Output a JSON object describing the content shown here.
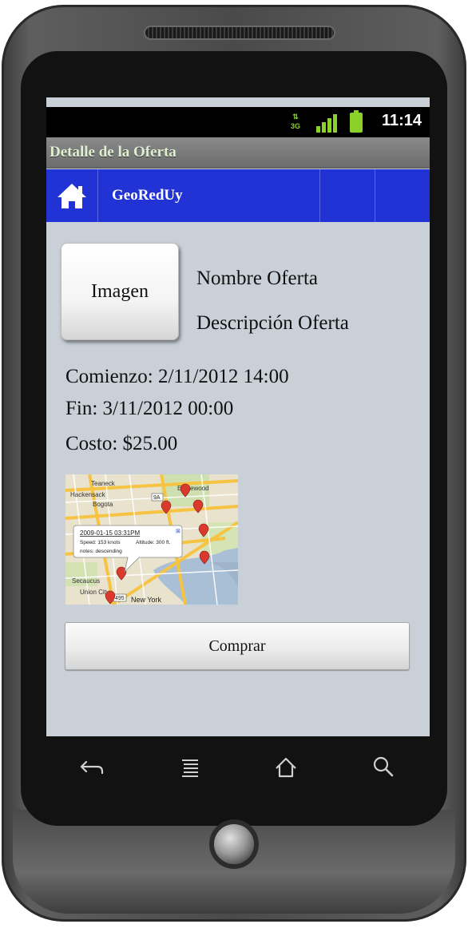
{
  "status_bar": {
    "network": "3G",
    "time": "11:14"
  },
  "title_bar": {
    "title": "Detalle de la Oferta"
  },
  "nav": {
    "app_name": "GeoRedUy",
    "home_icon": "home-icon"
  },
  "offer": {
    "image_label": "Imagen",
    "name": "Nombre Oferta",
    "description": "Descripción Oferta",
    "start": "Comienzo: 2/11/2012 14:00",
    "end": "Fin: 3/11/2012 00:00",
    "cost": "Costo: $25.00",
    "buy_button": "Comprar"
  },
  "map": {
    "labels": [
      "Teaneck",
      "Hackensack",
      "Bogota",
      "Englewood",
      "Secaucus",
      "Union City",
      "New York"
    ],
    "road_shields": [
      "9A",
      "495"
    ],
    "popup": {
      "date": "2009-01-15 03:31PM",
      "speed": "Speed: 153 knots",
      "altitude": "Altitude: 300 ft.",
      "notes": "notes: descending"
    }
  },
  "softkeys": [
    "back-arrow-icon",
    "menu-icon",
    "home-outline-icon",
    "search-icon"
  ],
  "colors": {
    "nav_blue": "#2233d6",
    "screen_bg": "#c9d0d8",
    "status_green": "#8bd12a"
  }
}
